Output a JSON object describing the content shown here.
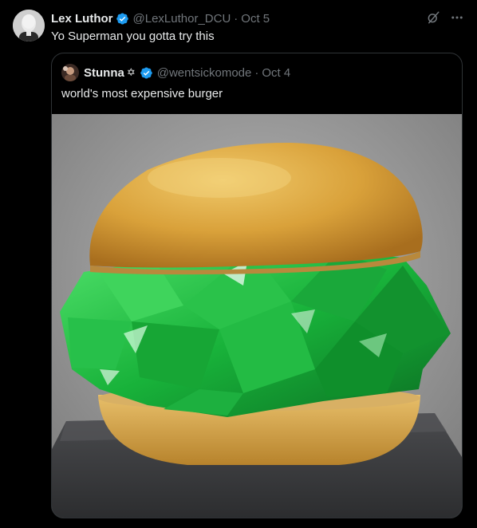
{
  "tweet": {
    "author": {
      "name": "Lex Luthor",
      "handle": "@LexLuthor_DCU",
      "date": "Oct 5",
      "verified": true
    },
    "text": "Yo Superman you gotta try this",
    "icons": [
      "grok-icon",
      "more-icon"
    ]
  },
  "quote": {
    "author": {
      "name": "Stunna",
      "badge": "✡",
      "handle": "@wentsickomode",
      "date": "Oct 4",
      "verified": true
    },
    "text": "world's most expensive burger",
    "media": {
      "subject": "burger with emerald gemstones as the patty",
      "colors": {
        "bun": "#d9a542",
        "emerald": "#19b13a",
        "background": "#9b9b9b",
        "stone": "#3a3b3d"
      }
    }
  },
  "colors": {
    "background": "#000000",
    "text": "#e7e9ea",
    "muted": "#71767b",
    "border": "#2f3336",
    "verified": "#1d9bf0"
  }
}
